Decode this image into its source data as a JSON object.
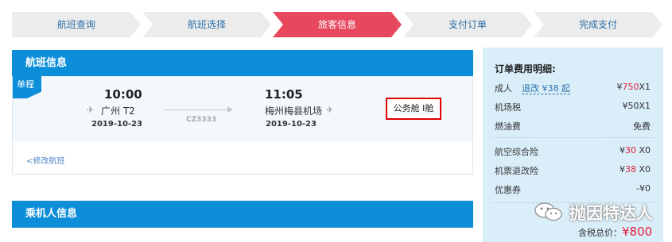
{
  "steps": [
    "航班查询",
    "航班选择",
    "旅客信息",
    "支付订单",
    "完成支付"
  ],
  "flight_section": {
    "title": "航班信息",
    "trip_tag": "单程",
    "departure": {
      "time": "10:00",
      "place": "广州 T2",
      "date": "2019-10-23"
    },
    "arrival": {
      "time": "11:05",
      "place": "梅州梅县机场",
      "date": "2019-10-23"
    },
    "flight_number": "CZ3333",
    "cabin": "公务舱 I舱",
    "modify_link": "<修改航班"
  },
  "passenger_section": {
    "title": "乘机人信息"
  },
  "fee_panel": {
    "title": "订单费用明细:",
    "adult_label": "成人",
    "refund_label": "退改 ¥38 起",
    "adult_currency": "¥",
    "adult_price": "750",
    "adult_multiplier": "X1",
    "airport_tax_label": "机场税",
    "airport_tax_value": "¥50X1",
    "fuel_label": "燃油费",
    "fuel_value": "免费",
    "insurance_label": "航空综合险",
    "insurance_currency": "¥",
    "insurance_price": "30",
    "insurance_multiplier": " X0",
    "refund_ins_label": "机票退改险",
    "refund_ins_currency": "¥",
    "refund_ins_price": "38",
    "refund_ins_multiplier": " X0",
    "coupon_label": "优惠券",
    "coupon_value": "-¥0",
    "total_label": "含税总价：",
    "total_currency": "¥",
    "total_value": "800"
  },
  "watermark": "抛因特达人",
  "colors": {
    "step_active": "#e8485e",
    "header_blue": "#0c8ed9",
    "highlight_box": "#e00000",
    "price_red": "#e0203a"
  }
}
